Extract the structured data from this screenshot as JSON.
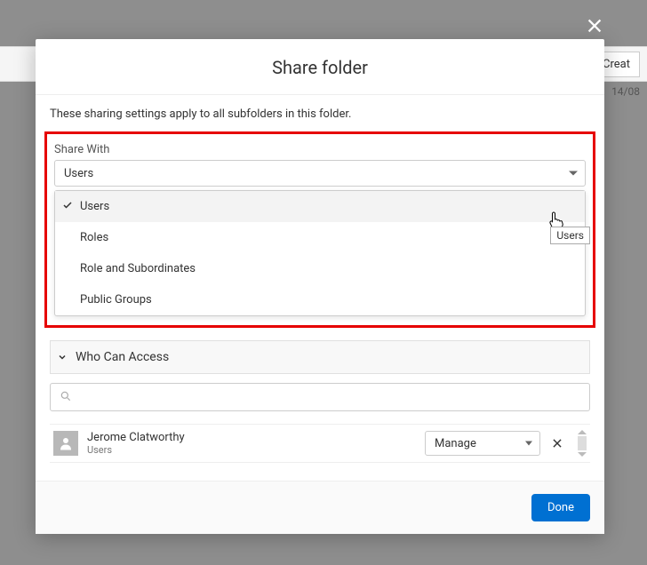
{
  "background": {
    "create_label": "Creat",
    "date_text": "14/08"
  },
  "modal": {
    "title": "Share folder",
    "helper": "These sharing settings apply to all subfolders in this folder.",
    "share_with_label": "Share With",
    "share_with_value": "Users",
    "dropdown_options": {
      "0": "Users",
      "1": "Roles",
      "2": "Role and Subordinates",
      "3": "Public Groups"
    },
    "tooltip": "Users",
    "who_can_access_label": "Who Can Access",
    "search_placeholder": "",
    "access_list": {
      "0": {
        "name": "Jerome Clatworthy",
        "type": "Users",
        "permission": "Manage"
      }
    },
    "done_label": "Done"
  }
}
